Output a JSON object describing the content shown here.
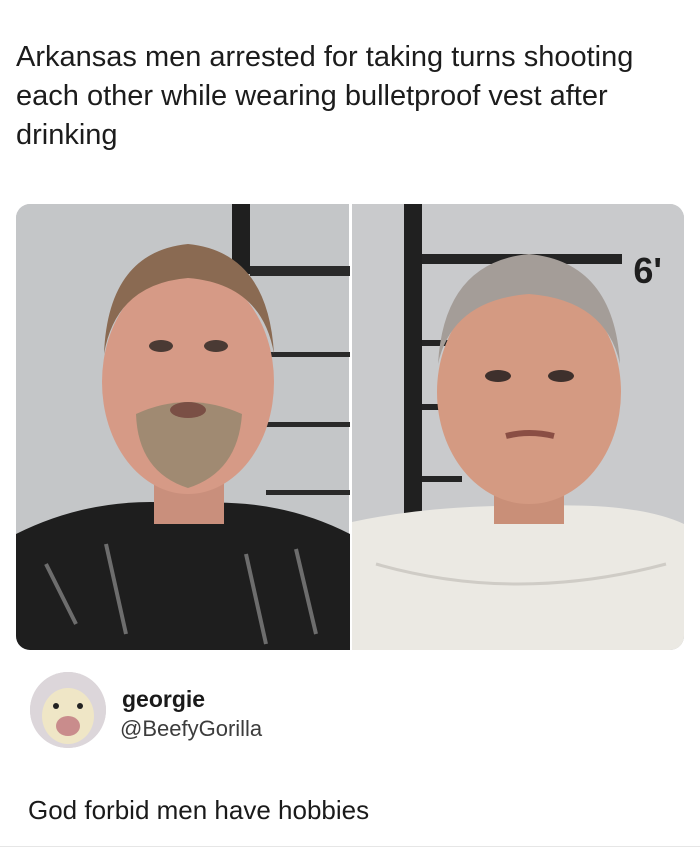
{
  "headline": "Arkansas men arrested for taking turns shooting each other while wearing bulletproof vest after drinking",
  "photo": {
    "height_mark": "6'",
    "colors": {
      "backdrop": "#c8c9ca",
      "skin": "#d9a08c",
      "shirt_left": "#202020",
      "shirt_right": "#ebe9e4"
    }
  },
  "tweet": {
    "user_name": "georgie",
    "user_handle": "@BeefyGorilla",
    "text": "God forbid men have hobbies"
  }
}
